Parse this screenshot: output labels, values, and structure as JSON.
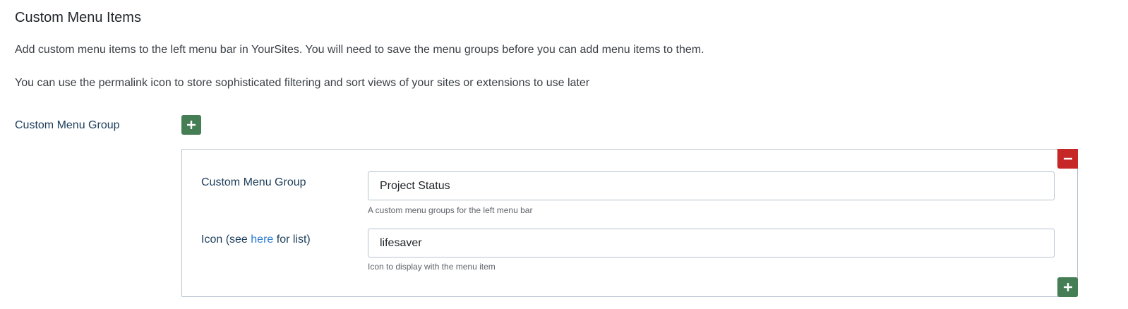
{
  "section": {
    "title": "Custom Menu Items",
    "description_1": "Add custom menu items to the left menu bar in YourSites. You will need to save the menu groups before you can add menu items to them.",
    "description_2": "You can use the permalink icon to store sophisticated filtering and sort views of your sites or extensions to use later"
  },
  "group": {
    "label": "Custom Menu Group",
    "add_icon": "plus-icon"
  },
  "subform": {
    "remove_icon": "minus-icon",
    "add_icon": "plus-icon",
    "fields": {
      "group_name": {
        "label": "Custom Menu Group",
        "value": "Project Status",
        "help": "A custom menu groups for the left menu bar"
      },
      "icon": {
        "label_prefix": "Icon (see ",
        "label_link": "here",
        "label_suffix": " for list)",
        "value": "lifesaver",
        "help": "Icon to display with the menu item"
      }
    }
  },
  "colors": {
    "add_button": "#457d54",
    "remove_button": "#c52827",
    "link": "#2a7bd4",
    "label": "#1c3d5a"
  }
}
